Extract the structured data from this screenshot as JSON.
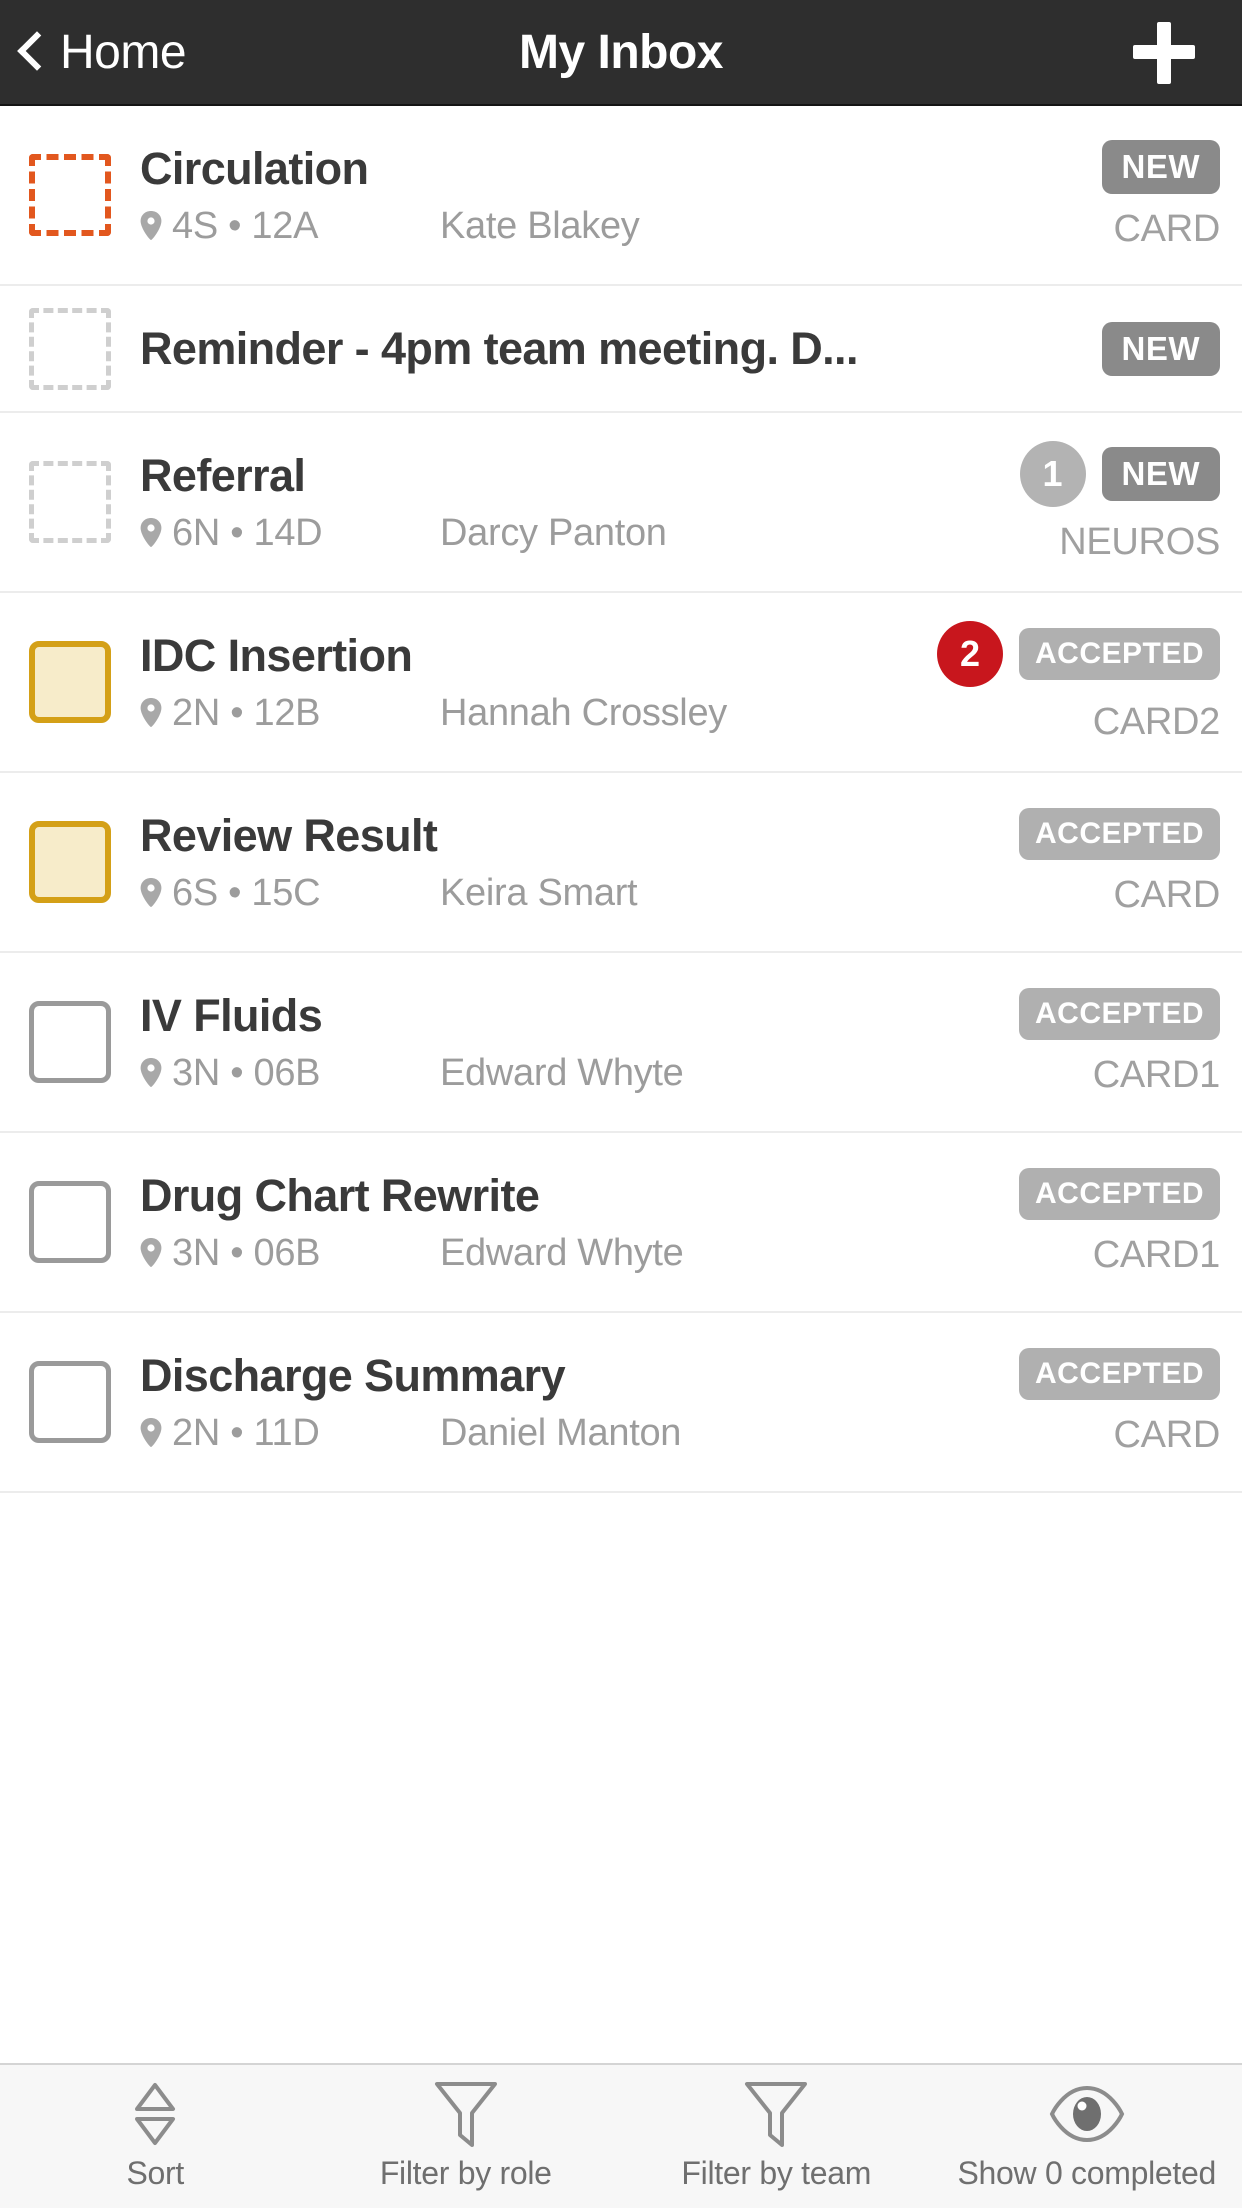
{
  "header": {
    "back_label": "Home",
    "title": "My Inbox",
    "back_icon": "chevron-left-icon",
    "add_icon": "plus-icon"
  },
  "list": {
    "rows": [
      {
        "title": "Circulation",
        "location": "4S • 12A",
        "patient": "Kate Blakey",
        "team": "CARD",
        "status": "NEW",
        "count": "",
        "checkbox": "dashed-orange",
        "layout": "tall"
      },
      {
        "title": "Reminder - 4pm team meeting. D...",
        "location": "",
        "patient": "",
        "team": "",
        "status": "NEW",
        "count": "",
        "checkbox": "dashed-gray",
        "layout": "short"
      },
      {
        "title": "Referral",
        "location": "6N • 14D",
        "patient": "Darcy Panton",
        "team": "NEUROS",
        "status": "NEW",
        "count": "1",
        "count_color": "gray",
        "checkbox": "dashed-gray",
        "layout": "tall"
      },
      {
        "title": "IDC Insertion",
        "location": "2N • 12B",
        "patient": "Hannah Crossley",
        "team": "CARD2",
        "status": "ACCEPTED",
        "count": "2",
        "count_color": "red",
        "checkbox": "filled-yellow",
        "layout": "tall"
      },
      {
        "title": "Review Result",
        "location": "6S • 15C",
        "patient": "Keira Smart",
        "team": "CARD",
        "status": "ACCEPTED",
        "count": "",
        "checkbox": "filled-yellow",
        "layout": "tall"
      },
      {
        "title": "IV Fluids",
        "location": "3N • 06B",
        "patient": "Edward Whyte",
        "team": "CARD1",
        "status": "ACCEPTED",
        "count": "",
        "checkbox": "plain-gray",
        "layout": "tall"
      },
      {
        "title": "Drug Chart Rewrite",
        "location": "3N • 06B",
        "patient": "Edward Whyte",
        "team": "CARD1",
        "status": "ACCEPTED",
        "count": "",
        "checkbox": "plain-gray",
        "layout": "tall"
      },
      {
        "title": "Discharge Summary",
        "location": "2N • 11D",
        "patient": "Daniel Manton",
        "team": "CARD",
        "status": "ACCEPTED",
        "count": "",
        "checkbox": "plain-gray",
        "layout": "tall"
      }
    ]
  },
  "toolbar": {
    "items": [
      {
        "label": "Sort",
        "icon": "sort-updown-icon"
      },
      {
        "label": "Filter by role",
        "icon": "funnel-icon"
      },
      {
        "label": "Filter by team",
        "icon": "funnel-icon"
      },
      {
        "label": "Show 0 completed",
        "icon": "eye-icon"
      }
    ]
  },
  "colors": {
    "header_bg": "#2e2e2e",
    "accent_orange": "#e2571e",
    "accent_yellow": "#d4a017",
    "badge_new": "#8a8a8a",
    "badge_accepted": "#b0b0b0",
    "badge_count_red": "#c8161d",
    "badge_count_gray": "#b3b3b3",
    "toolbar_bg": "#f7f7f7"
  }
}
